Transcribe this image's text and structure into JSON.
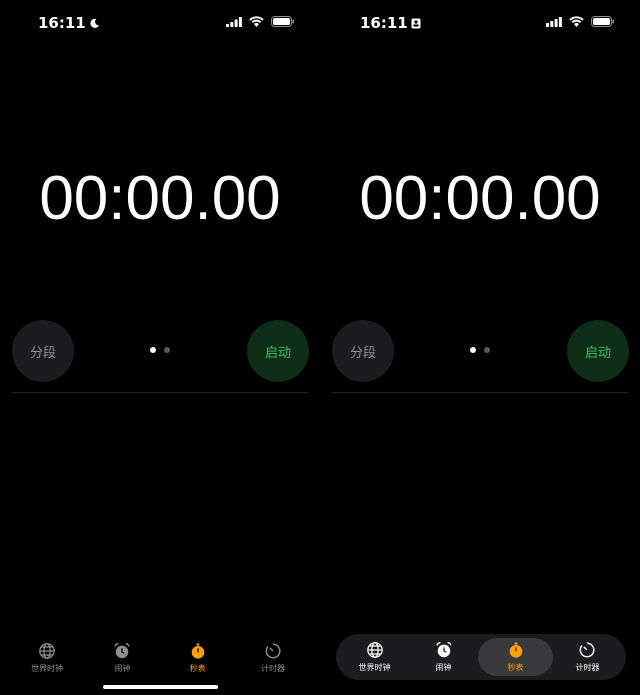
{
  "colors": {
    "accent": "#ff9f0a",
    "start_green": "#32c759",
    "lap_gray": "#8e8e93"
  },
  "left": {
    "status": {
      "time": "16:11",
      "focus_icon": "moon-icon"
    },
    "timer": "00:00.00",
    "lap_label": "分段",
    "start_label": "启动",
    "tabs": [
      {
        "label": "世界时钟",
        "icon": "globe-icon"
      },
      {
        "label": "闹钟",
        "icon": "alarm-clock-icon"
      },
      {
        "label": "秒表",
        "icon": "stopwatch-icon",
        "active": true
      },
      {
        "label": "计时器",
        "icon": "timer-icon"
      }
    ]
  },
  "right": {
    "status": {
      "time": "16:11",
      "focus_icon": "id-card-icon"
    },
    "timer": "00:00.00",
    "lap_label": "分段",
    "start_label": "启动",
    "tabs": [
      {
        "label": "世界时钟",
        "icon": "globe-icon"
      },
      {
        "label": "闹钟",
        "icon": "alarm-clock-icon"
      },
      {
        "label": "秒表",
        "icon": "stopwatch-icon",
        "active": true
      },
      {
        "label": "计时器",
        "icon": "timer-icon"
      }
    ]
  }
}
